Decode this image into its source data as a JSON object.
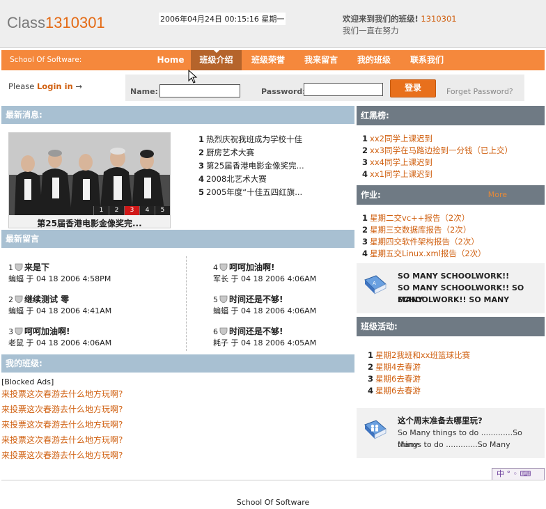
{
  "header": {
    "logo_text": "Class",
    "logo_number": "1310301",
    "datetime": "2006年04月24日  00:15:16  星期一",
    "welcome_prefix": "欢迎来到我们的班级!",
    "welcome_class": "1310301",
    "motto": "我们一直在努力"
  },
  "nav": {
    "school": "School Of Software:",
    "items": [
      {
        "label": "Home"
      },
      {
        "label": "班级介绍"
      },
      {
        "label": "班级荣誉"
      },
      {
        "label": "我来留言"
      },
      {
        "label": "我的班级"
      },
      {
        "label": "联系我们"
      }
    ]
  },
  "login": {
    "please": "Please",
    "login_link": "Login in",
    "arrow": "→",
    "name_label": "Name:",
    "password_label": "Password:",
    "name_value": "",
    "password_value": "",
    "button": "登录",
    "forgot": "Forget Password?"
  },
  "news": {
    "title": "最新消息:",
    "caption": "第25届香港电影金像奖完...",
    "pager": [
      "1",
      "2",
      "3",
      "4",
      "5"
    ],
    "items": [
      {
        "n": "1",
        "text": "热烈庆祝我班成为学校十佳"
      },
      {
        "n": "2",
        "text": "厨房艺术大赛"
      },
      {
        "n": "3",
        "text": "第25届香港电影金像奖完..."
      },
      {
        "n": "4",
        "text": "2008北艺术大赛"
      },
      {
        "n": "5",
        "text": "2005年度“十佳五四红旗..."
      }
    ]
  },
  "messages": {
    "title": "最新留言",
    "items": [
      {
        "n": "1",
        "title": "来是下",
        "author": "蝙蝠",
        "sep": "于",
        "time": "04 18 2006 4:58PM"
      },
      {
        "n": "2",
        "title": "继续测试 零",
        "author": "蝙蝠",
        "sep": "于",
        "time": "04 18 2006 4:41AM"
      },
      {
        "n": "3",
        "title": "呵呵加油啊!",
        "author": "老鼠",
        "sep": "于",
        "time": "04 18 2006 4:06AM"
      },
      {
        "n": "4",
        "title": "呵呵加油啊!",
        "author": "军长",
        "sep": "于",
        "time": "04 18 2006 4:06AM"
      },
      {
        "n": "5",
        "title": "时间还是不够!",
        "author": "蝙蝠",
        "sep": "于",
        "time": "04 18 2006 4:06AM"
      },
      {
        "n": "6",
        "title": "时间还是不够!",
        "author": "耗子",
        "sep": "于",
        "time": "04 18 2006 4:05AM"
      }
    ]
  },
  "myclass": {
    "title": "我的班级:",
    "blocked": "[Blocked Ads]",
    "links": [
      "来投票这次春游去什么地方玩啊?",
      "来投票这次春游去什么地方玩啊?",
      "来投票这次春游去什么地方玩啊?",
      "来投票这次春游去什么地方玩啊?",
      "来投票这次春游去什么地方玩啊?"
    ]
  },
  "honor": {
    "title": "红黑榜:",
    "items": [
      {
        "n": "1",
        "text": "xx2同学上课迟到"
      },
      {
        "n": "2",
        "text": "xx3同学在马路边捡到一分钱（已上交）"
      },
      {
        "n": "3",
        "text": "xx4同学上课迟到"
      },
      {
        "n": "4",
        "text": "xx1同学上课迟到"
      }
    ]
  },
  "homework": {
    "title": "作业:",
    "more": "More",
    "items": [
      {
        "n": "1",
        "text": "星期二交vc++报告（2次）"
      },
      {
        "n": "2",
        "text": "星期三交数据库报告（2次）"
      },
      {
        "n": "3",
        "text": "星期四交软件架构报告（2次）"
      },
      {
        "n": "4",
        "text": "星期五交Linux.xml报告（2次）"
      }
    ],
    "promo_title": "SO MANY SCHOOLWORK!!",
    "promo_line2": "SO MANY SCHOOLWORK!! SO MANY",
    "promo_line3": "SCHOOLWORK!! SO MANY"
  },
  "activity": {
    "title": "班级活动:",
    "items": [
      {
        "n": "1",
        "text": "星期2我班和xx班篮球比赛"
      },
      {
        "n": "2",
        "text": "星期4去春游"
      },
      {
        "n": "3",
        "text": "星期6去春游"
      },
      {
        "n": "4",
        "text": "星期6去春游"
      }
    ],
    "promo_title": "这个周末准备去哪里玩?",
    "promo_line2": "So Many things to do .............So Many",
    "promo_line3": "things to do .............So Many"
  },
  "footer": {
    "text": "School Of Software"
  },
  "ime": {
    "label": "中 ° ◦ ⌨"
  },
  "colors": {
    "accent": "#f5883c",
    "link": "#d06010",
    "head_blue": "#a8c0d2",
    "head_dark": "#6f7a84"
  }
}
